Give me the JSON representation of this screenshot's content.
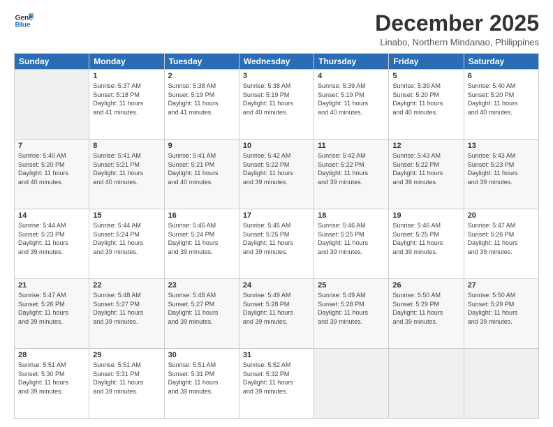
{
  "logo": {
    "line1": "General",
    "line2": "Blue"
  },
  "header": {
    "month": "December 2025",
    "location": "Linabo, Northern Mindanao, Philippines"
  },
  "weekdays": [
    "Sunday",
    "Monday",
    "Tuesday",
    "Wednesday",
    "Thursday",
    "Friday",
    "Saturday"
  ],
  "weeks": [
    [
      {
        "day": "",
        "info": ""
      },
      {
        "day": "1",
        "info": "Sunrise: 5:37 AM\nSunset: 5:18 PM\nDaylight: 11 hours\nand 41 minutes."
      },
      {
        "day": "2",
        "info": "Sunrise: 5:38 AM\nSunset: 5:19 PM\nDaylight: 11 hours\nand 41 minutes."
      },
      {
        "day": "3",
        "info": "Sunrise: 5:38 AM\nSunset: 5:19 PM\nDaylight: 11 hours\nand 40 minutes."
      },
      {
        "day": "4",
        "info": "Sunrise: 5:39 AM\nSunset: 5:19 PM\nDaylight: 11 hours\nand 40 minutes."
      },
      {
        "day": "5",
        "info": "Sunrise: 5:39 AM\nSunset: 5:20 PM\nDaylight: 11 hours\nand 40 minutes."
      },
      {
        "day": "6",
        "info": "Sunrise: 5:40 AM\nSunset: 5:20 PM\nDaylight: 11 hours\nand 40 minutes."
      }
    ],
    [
      {
        "day": "7",
        "info": "Sunrise: 5:40 AM\nSunset: 5:20 PM\nDaylight: 11 hours\nand 40 minutes."
      },
      {
        "day": "8",
        "info": "Sunrise: 5:41 AM\nSunset: 5:21 PM\nDaylight: 11 hours\nand 40 minutes."
      },
      {
        "day": "9",
        "info": "Sunrise: 5:41 AM\nSunset: 5:21 PM\nDaylight: 11 hours\nand 40 minutes."
      },
      {
        "day": "10",
        "info": "Sunrise: 5:42 AM\nSunset: 5:22 PM\nDaylight: 11 hours\nand 39 minutes."
      },
      {
        "day": "11",
        "info": "Sunrise: 5:42 AM\nSunset: 5:22 PM\nDaylight: 11 hours\nand 39 minutes."
      },
      {
        "day": "12",
        "info": "Sunrise: 5:43 AM\nSunset: 5:22 PM\nDaylight: 11 hours\nand 39 minutes."
      },
      {
        "day": "13",
        "info": "Sunrise: 5:43 AM\nSunset: 5:23 PM\nDaylight: 11 hours\nand 39 minutes."
      }
    ],
    [
      {
        "day": "14",
        "info": "Sunrise: 5:44 AM\nSunset: 5:23 PM\nDaylight: 11 hours\nand 39 minutes."
      },
      {
        "day": "15",
        "info": "Sunrise: 5:44 AM\nSunset: 5:24 PM\nDaylight: 11 hours\nand 39 minutes."
      },
      {
        "day": "16",
        "info": "Sunrise: 5:45 AM\nSunset: 5:24 PM\nDaylight: 11 hours\nand 39 minutes."
      },
      {
        "day": "17",
        "info": "Sunrise: 5:45 AM\nSunset: 5:25 PM\nDaylight: 11 hours\nand 39 minutes."
      },
      {
        "day": "18",
        "info": "Sunrise: 5:46 AM\nSunset: 5:25 PM\nDaylight: 11 hours\nand 39 minutes."
      },
      {
        "day": "19",
        "info": "Sunrise: 5:46 AM\nSunset: 5:25 PM\nDaylight: 11 hours\nand 39 minutes."
      },
      {
        "day": "20",
        "info": "Sunrise: 5:47 AM\nSunset: 5:26 PM\nDaylight: 11 hours\nand 39 minutes."
      }
    ],
    [
      {
        "day": "21",
        "info": "Sunrise: 5:47 AM\nSunset: 5:26 PM\nDaylight: 11 hours\nand 39 minutes."
      },
      {
        "day": "22",
        "info": "Sunrise: 5:48 AM\nSunset: 5:27 PM\nDaylight: 11 hours\nand 39 minutes."
      },
      {
        "day": "23",
        "info": "Sunrise: 5:48 AM\nSunset: 5:27 PM\nDaylight: 11 hours\nand 39 minutes."
      },
      {
        "day": "24",
        "info": "Sunrise: 5:49 AM\nSunset: 5:28 PM\nDaylight: 11 hours\nand 39 minutes."
      },
      {
        "day": "25",
        "info": "Sunrise: 5:49 AM\nSunset: 5:28 PM\nDaylight: 11 hours\nand 39 minutes."
      },
      {
        "day": "26",
        "info": "Sunrise: 5:50 AM\nSunset: 5:29 PM\nDaylight: 11 hours\nand 39 minutes."
      },
      {
        "day": "27",
        "info": "Sunrise: 5:50 AM\nSunset: 5:29 PM\nDaylight: 11 hours\nand 39 minutes."
      }
    ],
    [
      {
        "day": "28",
        "info": "Sunrise: 5:51 AM\nSunset: 5:30 PM\nDaylight: 11 hours\nand 39 minutes."
      },
      {
        "day": "29",
        "info": "Sunrise: 5:51 AM\nSunset: 5:31 PM\nDaylight: 11 hours\nand 39 minutes."
      },
      {
        "day": "30",
        "info": "Sunrise: 5:51 AM\nSunset: 5:31 PM\nDaylight: 11 hours\nand 39 minutes."
      },
      {
        "day": "31",
        "info": "Sunrise: 5:52 AM\nSunset: 5:32 PM\nDaylight: 11 hours\nand 39 minutes."
      },
      {
        "day": "",
        "info": ""
      },
      {
        "day": "",
        "info": ""
      },
      {
        "day": "",
        "info": ""
      }
    ]
  ]
}
